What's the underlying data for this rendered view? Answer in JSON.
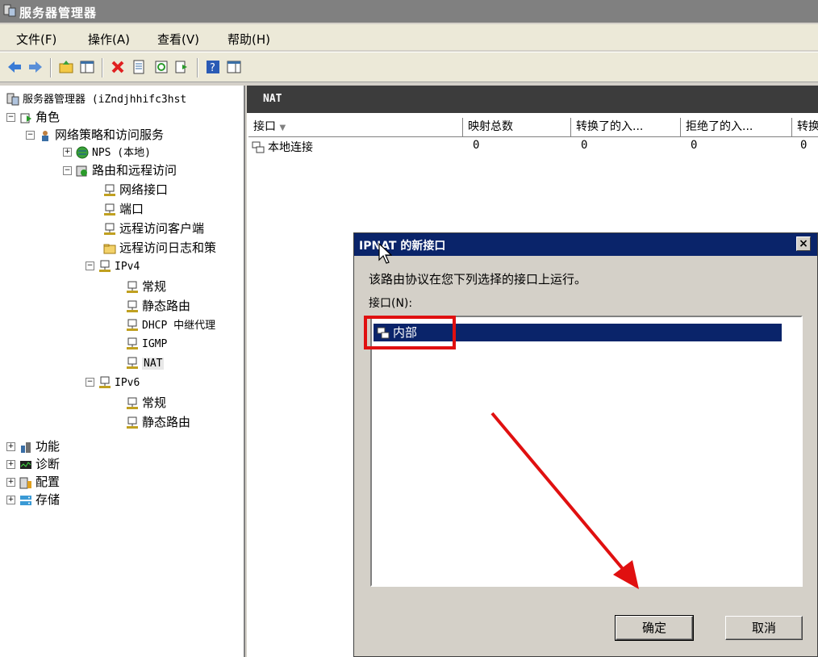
{
  "window": {
    "title": "服务器管理器"
  },
  "menu": [
    "文件(F)",
    "操作(A)",
    "查看(V)",
    "帮助(H)"
  ],
  "tree": {
    "root": "服务器管理器 (iZndjhhifc3hst",
    "roles": "角色",
    "nps_service": "网络策略和访问服务",
    "nps_local": "NPS (本地)",
    "rras": "路由和远程访问",
    "net_interfaces": "网络接口",
    "ports": "端口",
    "remote_clients": "远程访问客户端",
    "remote_logging": "远程访问日志和策",
    "ipv4": "IPv4",
    "ipv4_general": "常规",
    "ipv4_static": "静态路由",
    "ipv4_dhcp": "DHCP 中继代理",
    "ipv4_igmp": "IGMP",
    "ipv4_nat": "NAT",
    "ipv6": "IPv6",
    "ipv6_general": "常规",
    "ipv6_static": "静态路由",
    "features": "功能",
    "diagnostics": "诊断",
    "configuration": "配置",
    "storage": "存储"
  },
  "nat_panel": {
    "header": "NAT",
    "columns": [
      "接口",
      "映射总数",
      "转换了的入...",
      "拒绝了的入...",
      "转换"
    ],
    "rows": [
      {
        "name": "本地连接",
        "mappings": "0",
        "translated": "0",
        "rejected": "0",
        "other": "0"
      }
    ]
  },
  "dialog": {
    "title": "IPNAT 的新接口",
    "description": "该路由协议在您下列选择的接口上运行。",
    "list_label": "接口(N):",
    "items": [
      "内部"
    ],
    "ok": "确定",
    "cancel": "取消",
    "close": "×"
  }
}
